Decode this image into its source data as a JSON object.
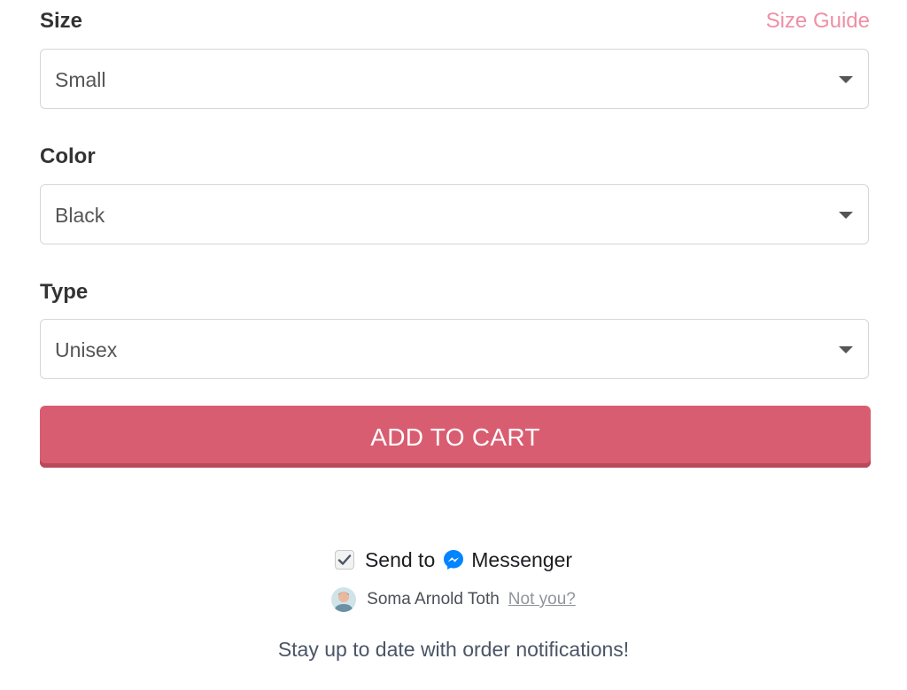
{
  "size": {
    "label": "Size",
    "guide_link": "Size Guide",
    "selected": "Small"
  },
  "color": {
    "label": "Color",
    "selected": "Black"
  },
  "type": {
    "label": "Type",
    "selected": "Unisex"
  },
  "cart": {
    "button_label": "ADD TO CART"
  },
  "messenger": {
    "checked": true,
    "send_to_label": "Send to",
    "messenger_label": "Messenger",
    "user_name": "Soma Arnold Toth",
    "not_you_label": "Not you?",
    "notification_text": "Stay up to date with order notifications!"
  },
  "colors": {
    "accent": "#d95d70",
    "size_guide": "#ef8fa6",
    "messenger_blue": "#0084ff"
  },
  "icons": {
    "dropdown": "caret-down-icon",
    "checkbox": "checkmark-icon",
    "messenger": "messenger-icon",
    "avatar": "user-avatar"
  }
}
